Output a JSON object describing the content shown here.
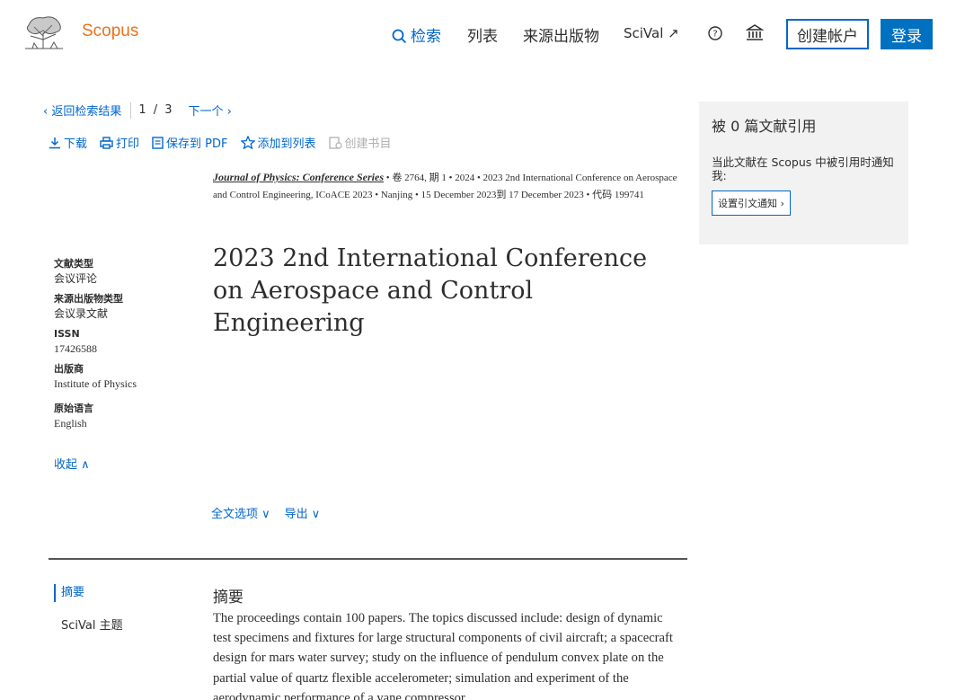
{
  "header": {
    "brand": "Scopus",
    "nav": {
      "search": "检索",
      "lists": "列表",
      "sources": "来源出版物",
      "scival": "SciVal ↗"
    },
    "create_account": "创建帐户",
    "login": "登录"
  },
  "result_nav": {
    "back": "‹ 返回检索结果",
    "position": "1 / 3",
    "next": "下一个 ›"
  },
  "toolbar": {
    "download": "下载",
    "print": "打印",
    "save_pdf": "保存到 PDF",
    "add_list": "添加到列表",
    "create_bib": "创建书目"
  },
  "source": {
    "journal": "Journal of Physics: Conference Series",
    "rest": " • 卷 2764, 期 1 • 2024 • 2023 2nd International Conference on Aerospace and Control Engineering, ICoACE 2023 • Nanjing • 15 December 2023到 17 December 2023 • 代码 199741"
  },
  "title": "2023 2nd International Conference on Aerospace and Control Engineering",
  "meta": {
    "doc_type_label": "文献类型",
    "doc_type": "会议评论",
    "source_type_label": "来源出版物类型",
    "source_type": "会议录文献",
    "issn_label": "ISSN",
    "issn": "17426588",
    "publisher_label": "出版商",
    "publisher": "Institute of Physics",
    "language_label": "原始语言",
    "language": "English",
    "collapse": "收起 ∧"
  },
  "options": {
    "full_text": "全文选项 ∨",
    "export": "导出 ∨"
  },
  "sections": {
    "abstract": "摘要",
    "scival": "SciVal 主题"
  },
  "abstract": {
    "heading": "摘要",
    "text": "The proceedings contain 100 papers. The topics discussed include: design of dynamic test specimens and fixtures for large structural components of civil aircraft; a spacecraft design for mars water survey; study on the influence of pendulum convex plate on the partial value of quartz flexible accelerometer; simulation and experiment of the aerodynamic performance of a vane compressor"
  },
  "cite_panel": {
    "title": "被 0 篇文献引用",
    "description": "当此文献在 Scopus 中被引用时通知我:",
    "alert": "设置引文通知 ›"
  }
}
